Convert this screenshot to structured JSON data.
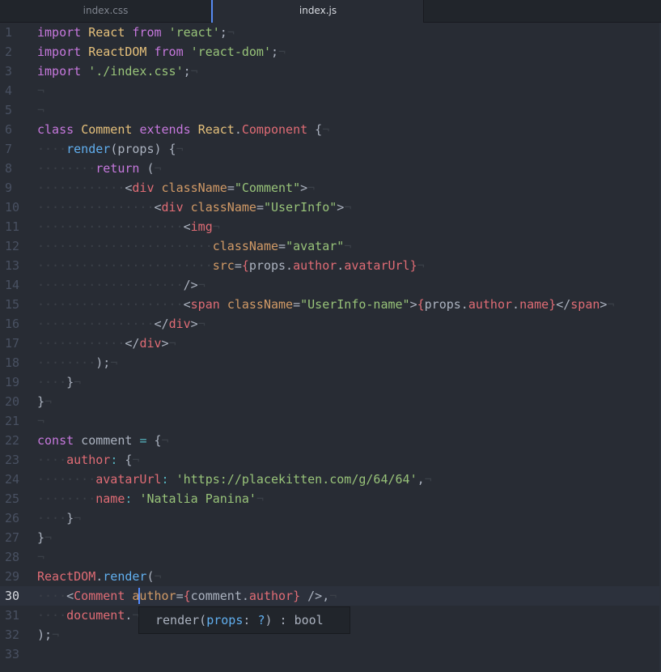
{
  "tabs": [
    {
      "label": "index.css",
      "active": false
    },
    {
      "label": "index.js",
      "active": true
    }
  ],
  "current_line": 30,
  "invisible_eol": "¬",
  "invisible_space": "·",
  "lines": [
    [
      [
        "k",
        "import"
      ],
      [
        "p",
        " "
      ],
      [
        "v",
        "React"
      ],
      [
        "p",
        " "
      ],
      [
        "k",
        "from"
      ],
      [
        "p",
        " "
      ],
      [
        "s",
        "'react'"
      ],
      [
        "p",
        ";"
      ]
    ],
    [
      [
        "k",
        "import"
      ],
      [
        "p",
        " "
      ],
      [
        "v",
        "ReactDOM"
      ],
      [
        "p",
        " "
      ],
      [
        "k",
        "from"
      ],
      [
        "p",
        " "
      ],
      [
        "s",
        "'react-dom'"
      ],
      [
        "p",
        ";"
      ]
    ],
    [
      [
        "k",
        "import"
      ],
      [
        "p",
        " "
      ],
      [
        "s",
        "'./index.css'"
      ],
      [
        "p",
        ";"
      ]
    ],
    [],
    [],
    [
      [
        "k",
        "class"
      ],
      [
        "p",
        " "
      ],
      [
        "v",
        "Comment"
      ],
      [
        "p",
        " "
      ],
      [
        "k",
        "extends"
      ],
      [
        "p",
        " "
      ],
      [
        "v",
        "React"
      ],
      [
        "p",
        "."
      ],
      [
        "t",
        "Component"
      ],
      [
        "p",
        " {"
      ]
    ],
    [
      [
        "g",
        "····"
      ],
      [
        "f",
        "render"
      ],
      [
        "p",
        "(props) {"
      ]
    ],
    [
      [
        "g",
        "········"
      ],
      [
        "k",
        "return"
      ],
      [
        "p",
        " ("
      ]
    ],
    [
      [
        "g",
        "············"
      ],
      [
        "p",
        "<"
      ],
      [
        "t",
        "div"
      ],
      [
        "p",
        " "
      ],
      [
        "a",
        "className"
      ],
      [
        "p",
        "="
      ],
      [
        "s",
        "\"Comment\""
      ],
      [
        "p",
        ">"
      ]
    ],
    [
      [
        "g",
        "················"
      ],
      [
        "p",
        "<"
      ],
      [
        "t",
        "div"
      ],
      [
        "p",
        " "
      ],
      [
        "a",
        "className"
      ],
      [
        "p",
        "="
      ],
      [
        "s",
        "\"UserInfo\""
      ],
      [
        "p",
        ">"
      ]
    ],
    [
      [
        "g",
        "····················"
      ],
      [
        "p",
        "<"
      ],
      [
        "t",
        "img"
      ]
    ],
    [
      [
        "g",
        "························"
      ],
      [
        "a",
        "className"
      ],
      [
        "p",
        "="
      ],
      [
        "s",
        "\"avatar\""
      ]
    ],
    [
      [
        "g",
        "························"
      ],
      [
        "a",
        "src"
      ],
      [
        "p",
        "="
      ],
      [
        "t",
        "{"
      ],
      [
        "p",
        "props."
      ],
      [
        "t",
        "author"
      ],
      [
        "p",
        "."
      ],
      [
        "t",
        "avatarUrl"
      ],
      [
        "t",
        "}"
      ]
    ],
    [
      [
        "g",
        "····················"
      ],
      [
        "p",
        "/>"
      ]
    ],
    [
      [
        "g",
        "····················"
      ],
      [
        "p",
        "<"
      ],
      [
        "t",
        "span"
      ],
      [
        "p",
        " "
      ],
      [
        "a",
        "className"
      ],
      [
        "p",
        "="
      ],
      [
        "s",
        "\"UserInfo-name\""
      ],
      [
        "p",
        ">"
      ],
      [
        "t",
        "{"
      ],
      [
        "p",
        "props."
      ],
      [
        "t",
        "author"
      ],
      [
        "p",
        "."
      ],
      [
        "t",
        "name"
      ],
      [
        "t",
        "}"
      ],
      [
        "p",
        "</"
      ],
      [
        "t",
        "span"
      ],
      [
        "p",
        ">"
      ]
    ],
    [
      [
        "g",
        "················"
      ],
      [
        "p",
        "</"
      ],
      [
        "t",
        "div"
      ],
      [
        "p",
        ">"
      ]
    ],
    [
      [
        "g",
        "············"
      ],
      [
        "p",
        "</"
      ],
      [
        "t",
        "div"
      ],
      [
        "p",
        ">"
      ]
    ],
    [
      [
        "g",
        "········"
      ],
      [
        "p",
        ");"
      ]
    ],
    [
      [
        "g",
        "····"
      ],
      [
        "p",
        "}"
      ]
    ],
    [
      [
        "p",
        "}"
      ]
    ],
    [],
    [
      [
        "k",
        "const"
      ],
      [
        "p",
        " comment "
      ],
      [
        "o",
        "="
      ],
      [
        "p",
        " {"
      ]
    ],
    [
      [
        "g",
        "····"
      ],
      [
        "t",
        "author"
      ],
      [
        "o",
        ":"
      ],
      [
        "p",
        " {"
      ]
    ],
    [
      [
        "g",
        "········"
      ],
      [
        "t",
        "avatarUrl"
      ],
      [
        "o",
        ":"
      ],
      [
        "p",
        " "
      ],
      [
        "s",
        "'https://placekitten.com/g/64/64'"
      ],
      [
        "p",
        ","
      ]
    ],
    [
      [
        "g",
        "········"
      ],
      [
        "t",
        "name"
      ],
      [
        "o",
        ":"
      ],
      [
        "p",
        " "
      ],
      [
        "s",
        "'Natalia Panina'"
      ]
    ],
    [
      [
        "g",
        "····"
      ],
      [
        "p",
        "}"
      ]
    ],
    [
      [
        "p",
        "}"
      ]
    ],
    [],
    [
      [
        "t",
        "ReactDOM"
      ],
      [
        "p",
        "."
      ],
      [
        "f",
        "render"
      ],
      [
        "p",
        "("
      ]
    ],
    [
      [
        "g",
        "····"
      ],
      [
        "p",
        "<"
      ],
      [
        "t",
        "Comment"
      ],
      [
        "p",
        " "
      ],
      [
        "a",
        "author"
      ],
      [
        "p",
        "="
      ],
      [
        "t",
        "{"
      ],
      [
        "p",
        "comment."
      ],
      [
        "t",
        "author"
      ],
      [
        "t",
        "}"
      ],
      [
        "p",
        " />,"
      ]
    ],
    [
      [
        "g",
        "····"
      ],
      [
        "t",
        "document"
      ],
      [
        "p",
        "."
      ]
    ],
    [
      [
        "p",
        ");"
      ]
    ],
    []
  ],
  "tooltip": {
    "parts": [
      [
        "p",
        "render("
      ],
      [
        "a2",
        "props"
      ],
      [
        "p",
        ": "
      ],
      [
        "a2",
        "?"
      ],
      [
        "p",
        ") : bool"
      ]
    ]
  }
}
